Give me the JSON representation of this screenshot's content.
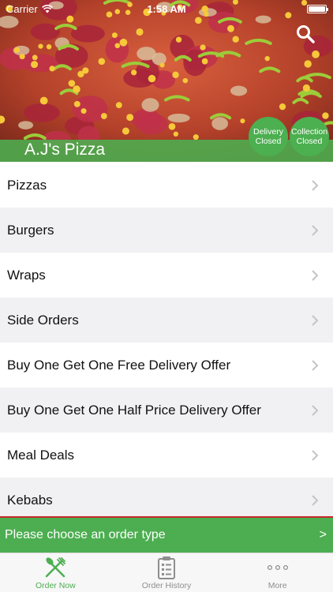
{
  "status_bar": {
    "carrier": "Carrier",
    "time": "1:58 AM"
  },
  "header": {
    "restaurant_name": "A.J's Pizza",
    "search_icon": "search-icon",
    "delivery_status": {
      "line1": "Delivery",
      "line2": "Closed"
    },
    "collection_status": {
      "line1": "Collection",
      "line2": "Closed"
    }
  },
  "menu": {
    "items": [
      {
        "label": "Pizzas"
      },
      {
        "label": "Burgers"
      },
      {
        "label": "Wraps"
      },
      {
        "label": "Side Orders"
      },
      {
        "label": "Buy One Get One Free Delivery Offer"
      },
      {
        "label": "Buy One Get One Half Price Delivery Offer"
      },
      {
        "label": "Meal Deals"
      },
      {
        "label": "Kebabs"
      }
    ]
  },
  "order_banner": {
    "text": "Please choose an order type",
    "arrow": ">"
  },
  "tab_bar": {
    "tabs": [
      {
        "label": "Order Now",
        "icon": "fork-knife-icon",
        "active": true
      },
      {
        "label": "Order History",
        "icon": "clipboard-icon",
        "active": false
      },
      {
        "label": "More",
        "icon": "more-dots-icon",
        "active": false
      }
    ]
  },
  "colors": {
    "brand_green": "#4caf50",
    "divider_red": "#c62828",
    "tab_inactive": "#8e8e8e"
  }
}
